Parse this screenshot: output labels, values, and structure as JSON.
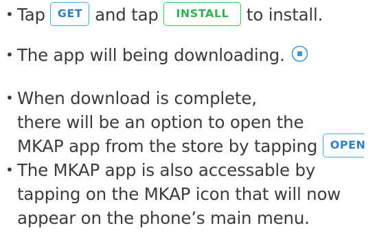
{
  "bullet": "•",
  "item1": {
    "part1": "Tap",
    "get_label": "GET",
    "part2": "and tap",
    "install_label": "INSTALL",
    "part3": "to install."
  },
  "item2": {
    "text": "The app will being downloading."
  },
  "item3": {
    "line1": "When download is complete,",
    "line2": "there will be an option to open the",
    "line3": "MKAP app from the store by tapping",
    "open_label": "OPEN"
  },
  "item4": {
    "line1": "The MKAP app is also accessable by",
    "line2": "tapping on the MKAP icon that will now",
    "line3": "appear on the phone’s main menu."
  },
  "colors": {
    "text": "#3b3b3b",
    "get_blue": "#2f7fc5",
    "install_green": "#2fb24f",
    "download_icon_blue": "#3a9ad9"
  },
  "icons": {
    "download_progress": "download-progress-icon"
  }
}
